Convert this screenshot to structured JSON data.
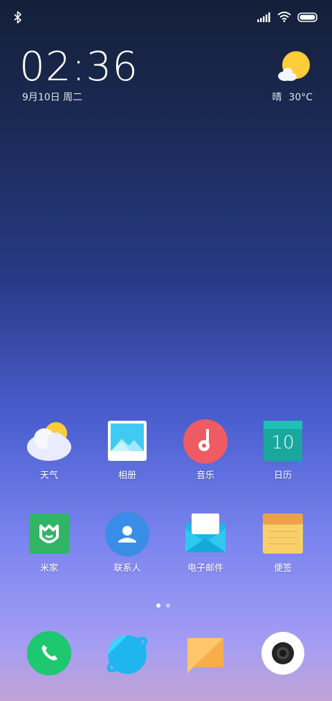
{
  "status_bar": {
    "bluetooth_icon": "bluetooth-icon",
    "signal_icon": "cellular-signal-icon",
    "wifi_icon": "wifi-icon",
    "battery_icon": "battery-icon"
  },
  "lockwidget": {
    "time": "02:36",
    "date": "9月10日 周二",
    "weather_condition": "晴",
    "temperature": "30°C"
  },
  "apps_row1": [
    {
      "label": "天气",
      "icon": "weather-icon"
    },
    {
      "label": "相册",
      "icon": "gallery-icon"
    },
    {
      "label": "音乐",
      "icon": "music-icon"
    },
    {
      "label": "日历",
      "icon": "calendar-icon",
      "day": "10"
    }
  ],
  "apps_row2": [
    {
      "label": "米家",
      "icon": "mijia-icon"
    },
    {
      "label": "联系人",
      "icon": "contacts-icon"
    },
    {
      "label": "电子邮件",
      "icon": "email-icon"
    },
    {
      "label": "便签",
      "icon": "notes-icon"
    }
  ],
  "page_indicator": {
    "total": 2,
    "active": 1
  },
  "dock": [
    {
      "icon": "phone-icon"
    },
    {
      "icon": "browser-icon"
    },
    {
      "icon": "messages-icon"
    },
    {
      "icon": "camera-icon"
    }
  ],
  "colors": {
    "phone_green": "#1ec86e",
    "browser_blue": "#1fb6f0",
    "music_red": "#ef5b63",
    "calendar_teal": "#1aa79e",
    "mijia_green": "#2fb563",
    "contacts_blue": "#3a8de6",
    "notes_yellow": "#f7d06b",
    "weather_sun": "#ffcc3a"
  }
}
